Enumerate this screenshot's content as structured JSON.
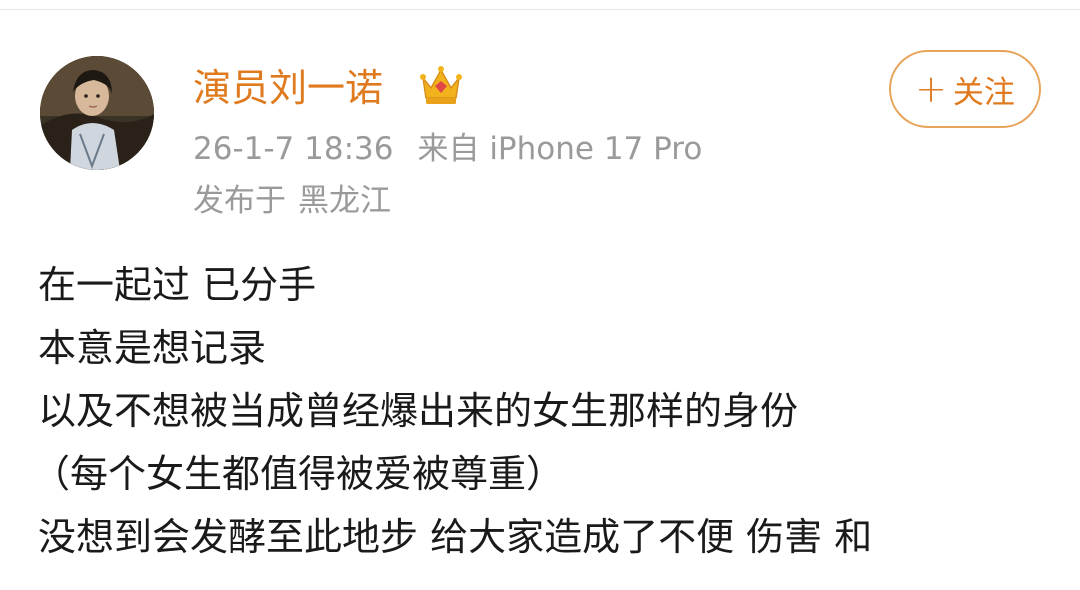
{
  "post": {
    "author": {
      "name": "演员刘一诺",
      "avatar_icon": "avatar-photo",
      "badge_icon": "crown-icon"
    },
    "timestamp": "26-1-7 18:36",
    "source": "来自 iPhone 17 Pro",
    "location_label": "发布于",
    "location_value": "黑龙江",
    "follow_button": {
      "icon": "plus-icon",
      "plus": "+",
      "label": "关注"
    },
    "content_lines": [
      "在一起过 已分手",
      "本意是想记录",
      "以及不想被当成曾经爆出来的女生那样的身份",
      "（每个女生都值得被爱被尊重）",
      "没想到会发酵至此地步 给大家造成了不便 伤害 和"
    ]
  },
  "colors": {
    "accent": "#e07a1f",
    "button_border": "#e8a35a",
    "meta_text": "#9a9a9a",
    "body_text": "#1a1a1a"
  }
}
